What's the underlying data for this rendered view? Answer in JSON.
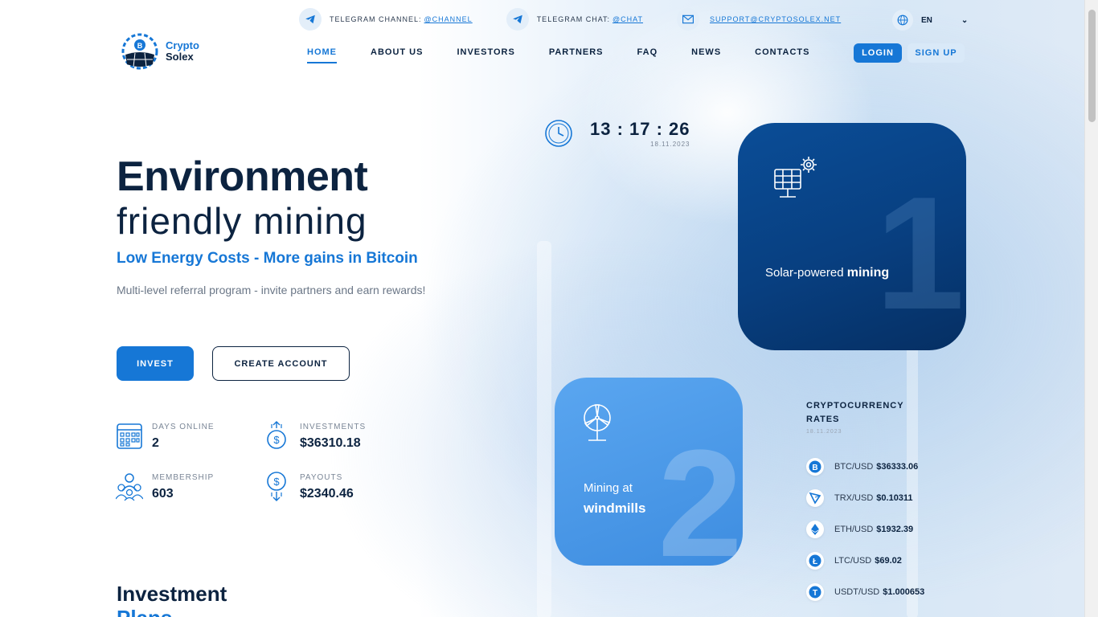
{
  "topbar": {
    "telegram_channel": {
      "label": "TELEGRAM CHANNEL:",
      "link": "@CHANNEL"
    },
    "telegram_chat": {
      "label": "TELEGRAM CHAT:",
      "link": "@CHAT"
    },
    "support": {
      "link": "SUPPORT@CRYPTOSOLEX.NET"
    },
    "language": "EN"
  },
  "logo": {
    "line1": "Crypto",
    "line2": "Solex"
  },
  "nav": {
    "items": [
      {
        "label": "HOME",
        "active": true
      },
      {
        "label": "ABOUT US"
      },
      {
        "label": "INVESTORS"
      },
      {
        "label": "PARTNERS"
      },
      {
        "label": "FAQ"
      },
      {
        "label": "NEWS"
      },
      {
        "label": "CONTACTS"
      }
    ],
    "login": "LOGIN",
    "signup": "SIGN UP"
  },
  "hero": {
    "title_bold": "Environment",
    "title_light": "friendly mining",
    "subtitle": "Low Energy Costs - More gains in Bitcoin",
    "description": "Multi-level referral program - invite partners and earn rewards!",
    "invest_button": "INVEST",
    "create_button": "CREATE ACCOUNT"
  },
  "stats": {
    "days_online": {
      "label": "DAYS ONLINE",
      "value": "2"
    },
    "investments": {
      "label": "INVESTMENTS",
      "value": "$36310.18"
    },
    "membership": {
      "label": "MEMBERSHIP",
      "value": "603"
    },
    "payouts": {
      "label": "PAYOUTS",
      "value": "$2340.46"
    }
  },
  "clock": {
    "time": "13 : 17 : 26",
    "date": "18.11.2023"
  },
  "cards": {
    "card1": {
      "number": "1",
      "text_normal": "Solar-powered ",
      "text_bold": "mining"
    },
    "card2": {
      "number": "2",
      "line1": "Mining at",
      "line2": "windmills"
    }
  },
  "rates": {
    "title_line1": "CRYPTOCURRENCY",
    "title_line2": "RATES",
    "date": "18.11.2023",
    "items": [
      {
        "pair": "BTC/USD",
        "price": "$36333.06",
        "icon": "bitcoin-icon",
        "color": "#1677d6"
      },
      {
        "pair": "TRX/USD",
        "price": "$0.10311",
        "icon": "tron-icon",
        "color": "#1677d6"
      },
      {
        "pair": "ETH/USD",
        "price": "$1932.39",
        "icon": "ethereum-icon",
        "color": "#1677d6"
      },
      {
        "pair": "LTC/USD",
        "price": "$69.02",
        "icon": "litecoin-icon",
        "color": "#1677d6"
      },
      {
        "pair": "USDT/USD",
        "price": "$1.000653",
        "icon": "tether-icon",
        "color": "#1677d6"
      }
    ]
  },
  "plans": {
    "line1": "Investment",
    "line2": "Plans"
  },
  "colors": {
    "accent": "#1677d6",
    "dark": "#0c2340",
    "card1": "#083f80",
    "card2": "#4996e6"
  }
}
